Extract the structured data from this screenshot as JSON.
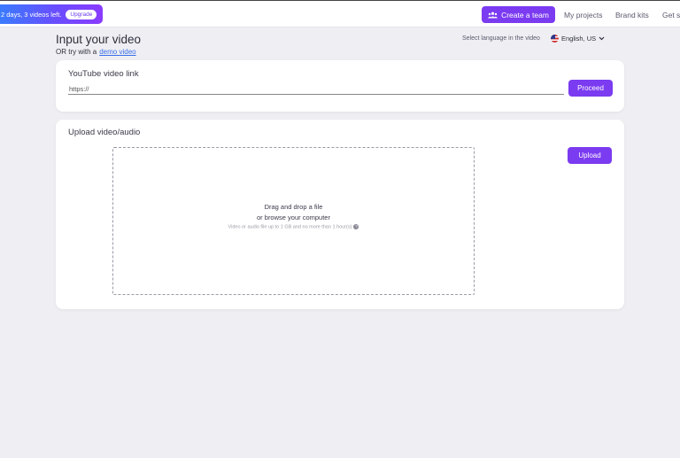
{
  "topbar": {
    "trial_text": "2 days, 3 videos left.",
    "upgrade_label": "Upgrade",
    "create_team_label": "Create a team",
    "nav": [
      "My projects",
      "Brand kits",
      "Get st"
    ]
  },
  "header": {
    "title": "Input your video",
    "demo_prefix": "OR try with a",
    "demo_link": "demo video",
    "language_label": "Select language in the video",
    "language_value": "English, US"
  },
  "youtube": {
    "title": "YouTube video link",
    "input_value": "https://",
    "proceed_label": "Proceed"
  },
  "upload": {
    "title": "Upload video/audio",
    "upload_label": "Upload",
    "drop_line1": "Drag and drop a file",
    "drop_line2": "or browse your computer",
    "hint": "Video or audio file up to 1 GB and no more than 1 hour(s)",
    "help_glyph": "?"
  },
  "colors": {
    "accent": "#7b3bf0",
    "link": "#3a6ee8",
    "background": "#efeff3"
  }
}
